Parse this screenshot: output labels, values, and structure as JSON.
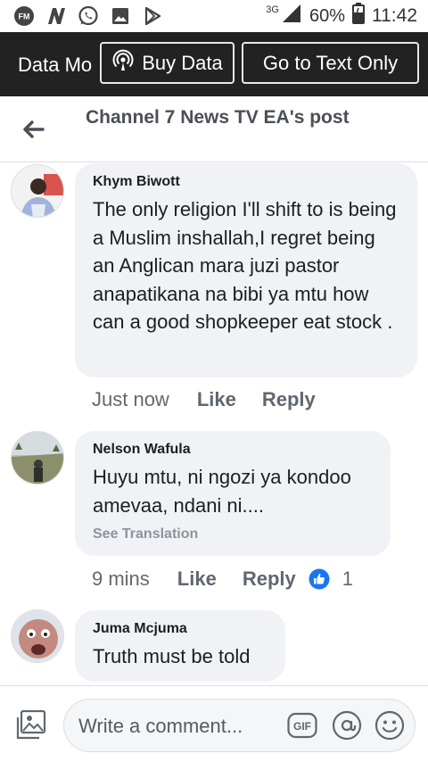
{
  "status_bar": {
    "network": "3G",
    "battery": "60%",
    "time": "11:42",
    "icons": [
      "fm-radio-icon",
      "news-n-icon",
      "whatsapp-icon",
      "gallery-icon",
      "play-store-icon",
      "signal-icon",
      "battery-icon"
    ]
  },
  "data_bar": {
    "mode_label": "Data Mo",
    "buy_data_label": "Buy Data",
    "text_only_label": "Go to Text Only"
  },
  "header": {
    "title": "Channel 7 News TV EA's post"
  },
  "comments": [
    {
      "author": "Khym Biwott",
      "text": "The only religion I'll shift to is being a Muslim inshallah,I regret being an Anglican mara juzi pastor anapatikana na bibi ya mtu how can a good shopkeeper eat stock .",
      "time": "Just now",
      "like": "Like",
      "reply": "Reply"
    },
    {
      "author": "Nelson Wafula",
      "text": "Huyu mtu, ni ngozi ya kondoo amevaa, ndani ni....",
      "see_translation": "See Translation",
      "time": "9 mins",
      "like": "Like",
      "reply": "Reply",
      "reaction_count": "1"
    },
    {
      "author": "Juma Mcjuma",
      "text": "Truth must be told"
    }
  ],
  "composer": {
    "placeholder": "Write a comment..."
  },
  "colors": {
    "data_bar_bg": "#222222",
    "bubble_bg": "#f0f2f5",
    "like_blue": "#1877f2"
  }
}
